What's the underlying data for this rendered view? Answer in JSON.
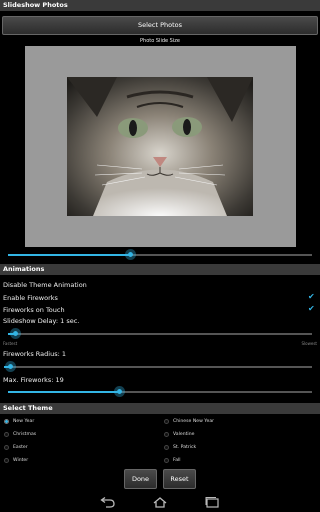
{
  "app": {
    "title": "Slideshow Photos"
  },
  "photos": {
    "select_button": "Select Photos",
    "size_label": "Photo Slide Size",
    "size_value": 0.48
  },
  "animations": {
    "header": "Animations",
    "disable_theme": {
      "label": "Disable Theme Animation",
      "checked": false
    },
    "enable_fireworks": {
      "label": "Enable Fireworks",
      "checked": true
    },
    "fireworks_on_touch": {
      "label": "Fireworks on Touch",
      "checked": true
    },
    "slideshow_delay": {
      "label": "Slideshow Delay: 1 sec.",
      "fastest": "Fastest",
      "slowest": "Slowest",
      "value": 0.02
    },
    "fireworks_radius": {
      "label": "Fireworks Radius: 1",
      "value": 0.02
    },
    "max_fireworks": {
      "label": "Max. Fireworks: 19",
      "value": 0.36
    }
  },
  "theme": {
    "header": "Select Theme",
    "options": [
      {
        "label": "New Year",
        "selected": true
      },
      {
        "label": "Chinese New Year",
        "selected": false
      },
      {
        "label": "Christmas",
        "selected": false
      },
      {
        "label": "Valentine",
        "selected": false
      },
      {
        "label": "Easter",
        "selected": false
      },
      {
        "label": "St. Patrick",
        "selected": false
      },
      {
        "label": "Winter",
        "selected": false
      },
      {
        "label": "Fall",
        "selected": false
      }
    ]
  },
  "actions": {
    "done": "Done",
    "reset": "Reset"
  },
  "nav": {
    "icons": [
      "back-icon",
      "home-icon",
      "recent-apps-icon"
    ]
  },
  "colors": {
    "accent": "#33b5e5",
    "header_bg": "#3a3a3a"
  }
}
